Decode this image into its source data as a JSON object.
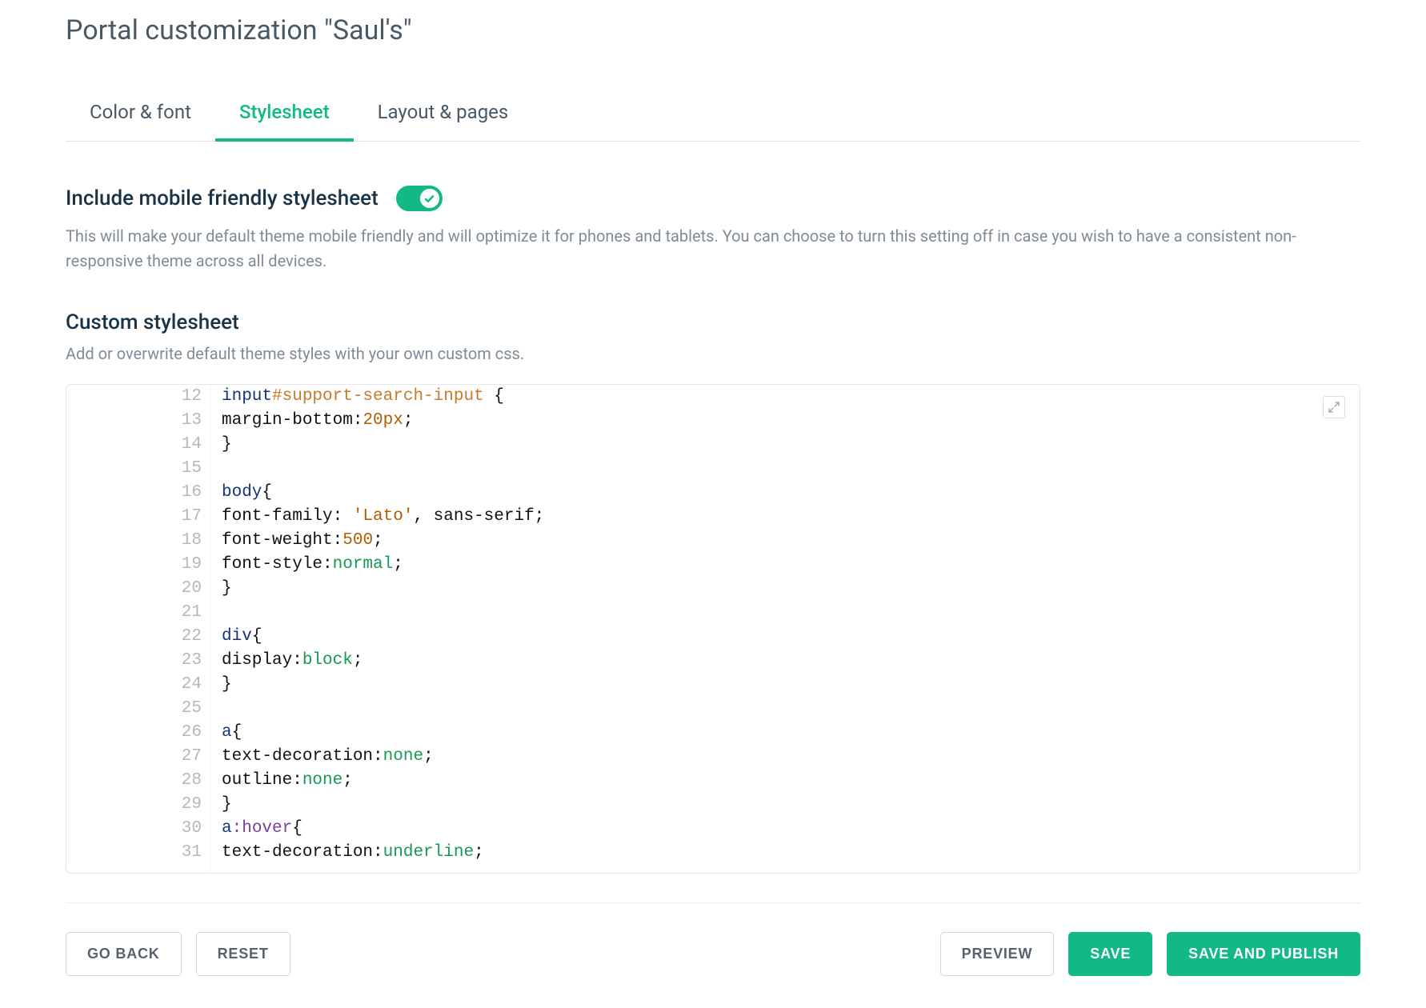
{
  "page_title": "Portal customization \"Saul's\"",
  "tabs": [
    {
      "label": "Color & font",
      "active": false
    },
    {
      "label": "Stylesheet",
      "active": true
    },
    {
      "label": "Layout & pages",
      "active": false
    }
  ],
  "mobile_section": {
    "title": "Include mobile friendly stylesheet",
    "toggle_on": true,
    "description": "This will make your default theme mobile friendly and will optimize it for phones and tablets. You can choose to turn this setting off in case you wish to have a consistent non-responsive theme across all devices."
  },
  "custom_section": {
    "title": "Custom stylesheet",
    "description": "Add or overwrite default theme styles with your own custom css."
  },
  "editor": {
    "line_start": 12,
    "lines": [
      [
        [
          "tag",
          "input"
        ],
        [
          "id",
          "#support-search-input"
        ],
        [
          "punct",
          " {"
        ]
      ],
      [
        [
          "prop",
          "margin-bottom:"
        ],
        [
          "num",
          "20px"
        ],
        [
          "punct",
          ";"
        ]
      ],
      [
        [
          "punct",
          "}"
        ]
      ],
      [],
      [
        [
          "tag",
          "body"
        ],
        [
          "punct",
          "{"
        ]
      ],
      [
        [
          "prop",
          "font-family: "
        ],
        [
          "str",
          "'Lato'"
        ],
        [
          "punct",
          ", sans-serif;"
        ]
      ],
      [
        [
          "prop",
          "font-weight:"
        ],
        [
          "num",
          "500"
        ],
        [
          "punct",
          ";"
        ]
      ],
      [
        [
          "prop",
          "font-style:"
        ],
        [
          "val",
          "normal"
        ],
        [
          "punct",
          ";"
        ]
      ],
      [
        [
          "punct",
          "}"
        ]
      ],
      [],
      [
        [
          "tag",
          "div"
        ],
        [
          "punct",
          "{"
        ]
      ],
      [
        [
          "prop",
          "display:"
        ],
        [
          "val",
          "block"
        ],
        [
          "punct",
          ";"
        ]
      ],
      [
        [
          "punct",
          "}"
        ]
      ],
      [],
      [
        [
          "tag",
          "a"
        ],
        [
          "punct",
          "{"
        ]
      ],
      [
        [
          "prop",
          "text-decoration:"
        ],
        [
          "val",
          "none"
        ],
        [
          "punct",
          ";"
        ]
      ],
      [
        [
          "prop",
          "outline:"
        ],
        [
          "val",
          "none"
        ],
        [
          "punct",
          ";"
        ]
      ],
      [
        [
          "punct",
          "}"
        ]
      ],
      [
        [
          "tag",
          "a"
        ],
        [
          "pseudo",
          ":hover"
        ],
        [
          "punct",
          "{"
        ]
      ],
      [
        [
          "prop",
          "text-decoration:"
        ],
        [
          "val",
          "underline"
        ],
        [
          "punct",
          ";"
        ]
      ]
    ]
  },
  "buttons": {
    "go_back": "GO BACK",
    "reset": "RESET",
    "preview": "PREVIEW",
    "save": "SAVE",
    "save_publish": "SAVE AND PUBLISH"
  }
}
